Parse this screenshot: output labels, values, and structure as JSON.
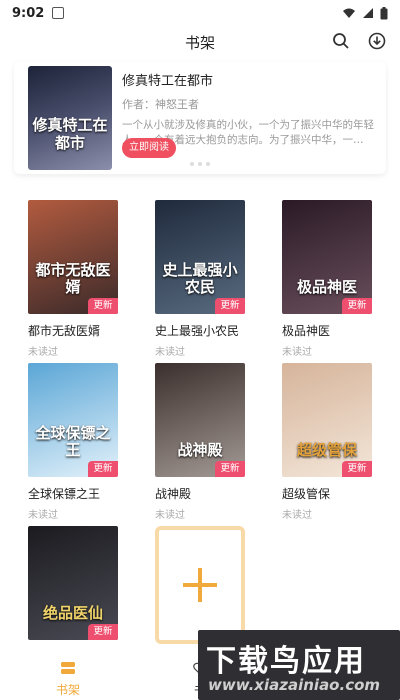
{
  "status_bar": {
    "time": "9:02"
  },
  "header": {
    "title": "书架"
  },
  "featured": {
    "cover_title": "修真特工在都市",
    "title": "修真特工在都市",
    "author": "作者：神怒王者",
    "description": "一个从小就涉及修真的小伙，一个为了振兴中华的年轻人，一个有着远大抱负的志向。为了振兴中华，一…",
    "read_button": "立即阅读"
  },
  "books": [
    {
      "title": "都市无敌医婿",
      "cover_title": "都市无敌医婿",
      "status": "未读过",
      "badge": "更新",
      "colors": [
        "#b25b3f",
        "#3b2a2a"
      ]
    },
    {
      "title": "史上最强小农民",
      "cover_title": "史上最强小农民",
      "status": "未读过",
      "badge": "更新",
      "colors": [
        "#1f2a3c",
        "#596b80"
      ]
    },
    {
      "title": "极品神医",
      "cover_title": "极品神医",
      "status": "未读过",
      "badge": "更新",
      "colors": [
        "#2a1a26",
        "#6a4f5c"
      ]
    },
    {
      "title": "全球保镖之王",
      "cover_title": "全球保镖之王",
      "status": "未读过",
      "badge": "更新",
      "colors": [
        "#5aa6d6",
        "#e2f1fa"
      ]
    },
    {
      "title": "战神殿",
      "cover_title": "战神殿",
      "status": "未读过",
      "badge": "更新",
      "colors": [
        "#3a2f2c",
        "#a49a95"
      ]
    },
    {
      "title": "超级管保",
      "cover_title": "超级管保",
      "status": "未读过",
      "badge": "更新",
      "colors": [
        "#d6b49a",
        "#f3e6d9"
      ]
    },
    {
      "title": "",
      "cover_title": "绝品医仙",
      "status": "",
      "badge": "更新",
      "colors": [
        "#1b1b1f",
        "#4a4a55"
      ]
    }
  ],
  "bottom_nav": {
    "bookshelf": "书架",
    "second_partial": "书"
  },
  "watermark": {
    "title": "下载鸟应用",
    "url": "www.xiazainiao.com"
  },
  "colors": {
    "accent": "#f2a93b",
    "badge": "#ef4f6f",
    "read_button": "#ef4f5f"
  }
}
